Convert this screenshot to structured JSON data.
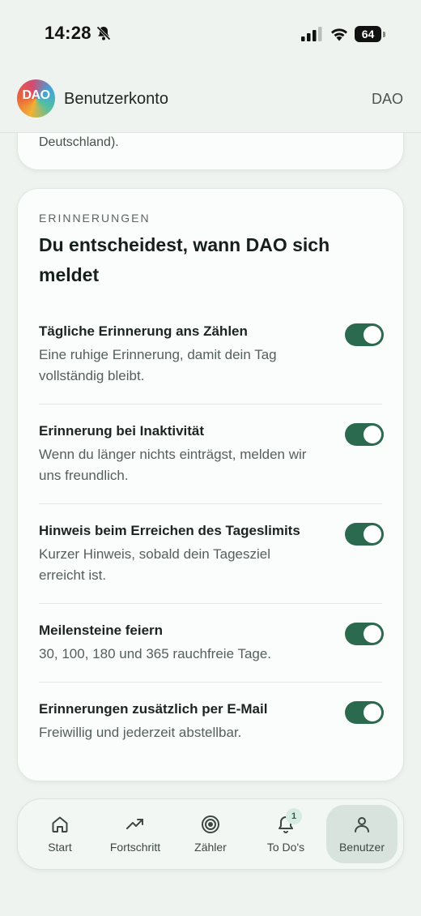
{
  "status_bar": {
    "time": "14:28",
    "battery": "64",
    "icons": [
      "bell-slash-icon",
      "cellular-signal-icon",
      "wifi-icon",
      "battery-icon"
    ]
  },
  "header": {
    "logo_text": "DAO",
    "title": "Benutzerkonto",
    "right_label": "DAO"
  },
  "previous_card": {
    "trailing_text": "Deutschland)."
  },
  "reminders": {
    "eyebrow": "ERINNERUNGEN",
    "heading": "Du entscheidest, wann DAO sich meldet",
    "toggle_color": "#2c6a50",
    "items": [
      {
        "title": "Tägliche Erinnerung ans Zählen",
        "description": "Eine ruhige Erinnerung, damit dein Tag vollständig bleibt.",
        "enabled": true
      },
      {
        "title": "Erinnerung bei Inaktivität",
        "description": "Wenn du länger nichts einträgst, melden wir uns freundlich.",
        "enabled": true
      },
      {
        "title": "Hinweis beim Erreichen des Tageslimits",
        "description": "Kurzer Hinweis, sobald dein Tagesziel erreicht ist.",
        "enabled": true
      },
      {
        "title": "Meilensteine feiern",
        "description": "30, 100, 180 und 365 rauchfreie Tage.",
        "enabled": true
      },
      {
        "title": "Erinnerungen zusätzlich per E-Mail",
        "description": "Freiwillig und jederzeit abstellbar.",
        "enabled": true
      }
    ]
  },
  "bottom_nav": {
    "items": [
      {
        "label": "Start",
        "icon": "home-icon",
        "active": false
      },
      {
        "label": "Fortschritt",
        "icon": "trending-up-icon",
        "active": false
      },
      {
        "label": "Zähler",
        "icon": "target-icon",
        "active": false
      },
      {
        "label": "To Do's",
        "icon": "bell-icon",
        "badge": "1",
        "active": false
      },
      {
        "label": "Benutzer",
        "icon": "user-icon",
        "active": true
      }
    ]
  }
}
